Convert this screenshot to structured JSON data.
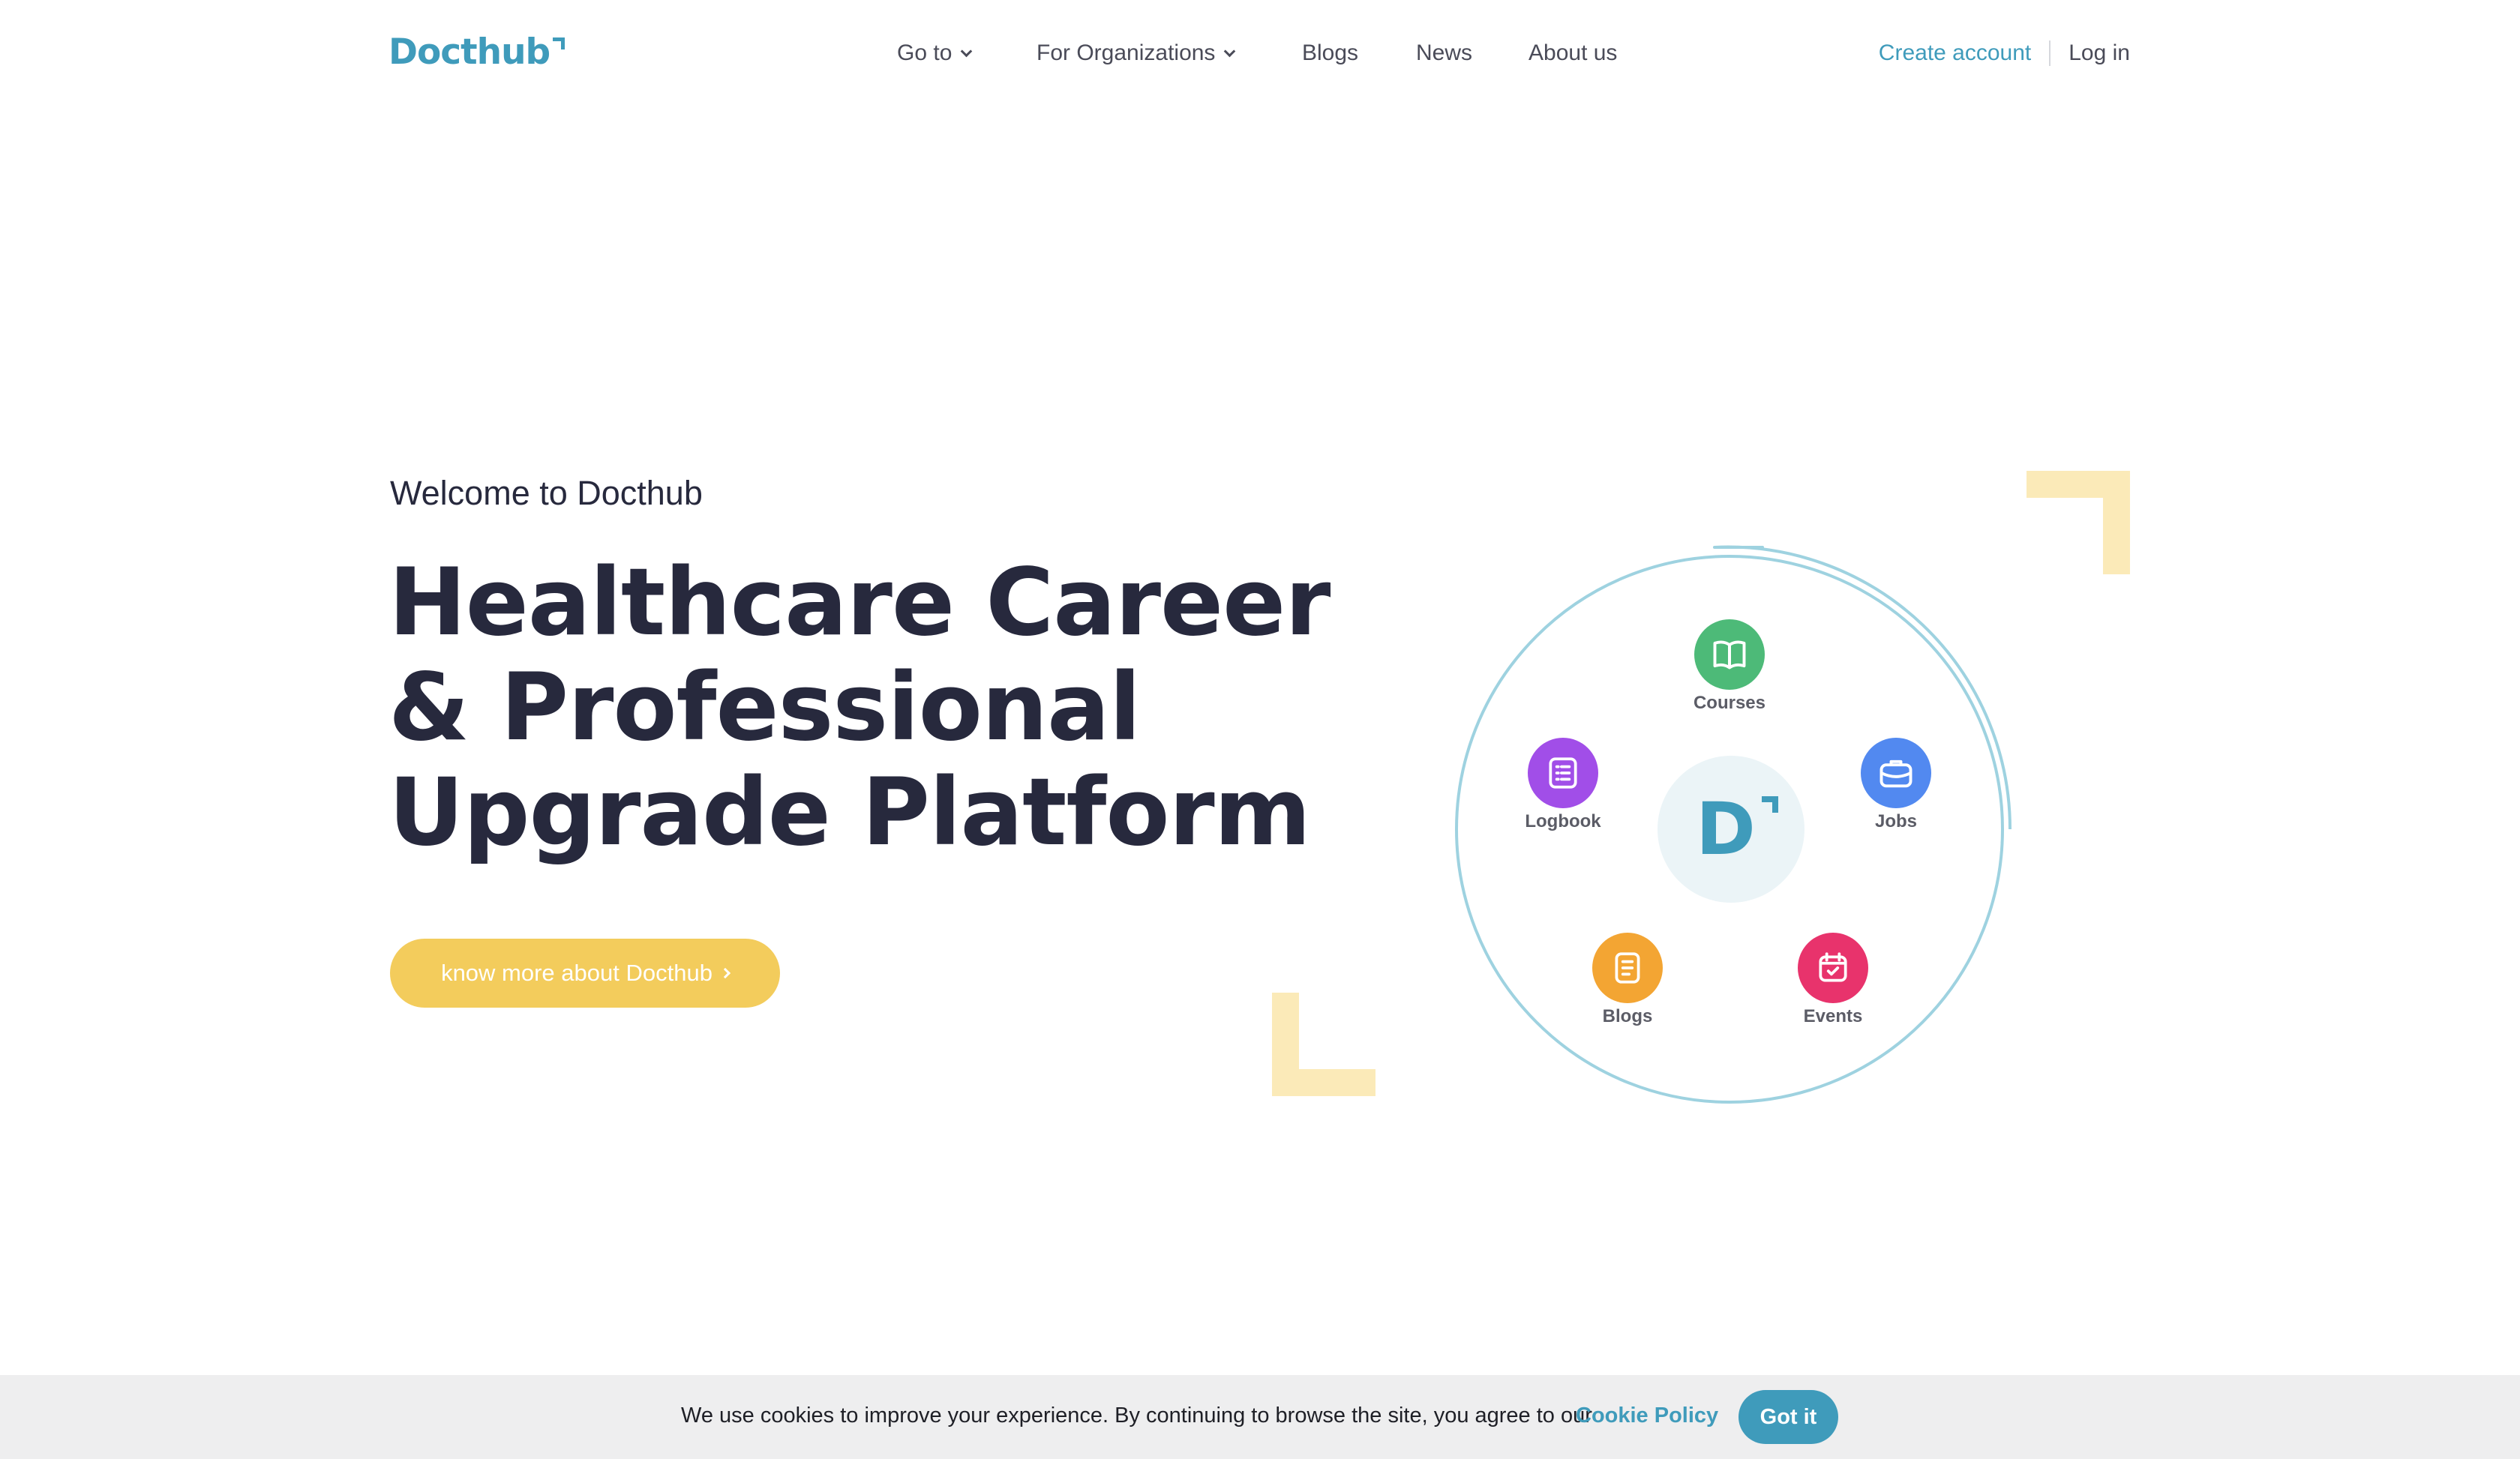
{
  "header": {
    "logo_text": "Docthub",
    "nav": [
      {
        "label": "Go to",
        "has_dropdown": true
      },
      {
        "label": "For Organizations",
        "has_dropdown": true
      },
      {
        "label": "Blogs",
        "has_dropdown": false
      },
      {
        "label": "News",
        "has_dropdown": false
      },
      {
        "label": "About us",
        "has_dropdown": false
      }
    ],
    "create_account": "Create account",
    "login": "Log in"
  },
  "hero": {
    "welcome": "Welcome to Docthub",
    "headline_lines": [
      "Healthcare Career",
      "& Professional",
      "Upgrade Platform"
    ],
    "cta_label": "know more about Docthub"
  },
  "orbit": {
    "center_letter": "D",
    "nodes": [
      {
        "label": "Courses",
        "icon": "open-book-icon",
        "color": "#4dba78"
      },
      {
        "label": "Logbook",
        "icon": "list-icon",
        "color": "#a14ee8"
      },
      {
        "label": "Jobs",
        "icon": "briefcase-icon",
        "color": "#5289f0"
      },
      {
        "label": "Blogs",
        "icon": "document-icon",
        "color": "#f3a533"
      },
      {
        "label": "Events",
        "icon": "calendar-check-icon",
        "color": "#e8336c"
      }
    ]
  },
  "cookie": {
    "message": "We use cookies to improve your experience. By continuing to browse the site, you agree to our",
    "policy_link": "Cookie Policy",
    "button": "Got it"
  },
  "colors": {
    "brand": "#3f9bbb",
    "cta": "#f3cc5c",
    "accent_light": "#fbeab8",
    "text_dark": "#27293d"
  }
}
